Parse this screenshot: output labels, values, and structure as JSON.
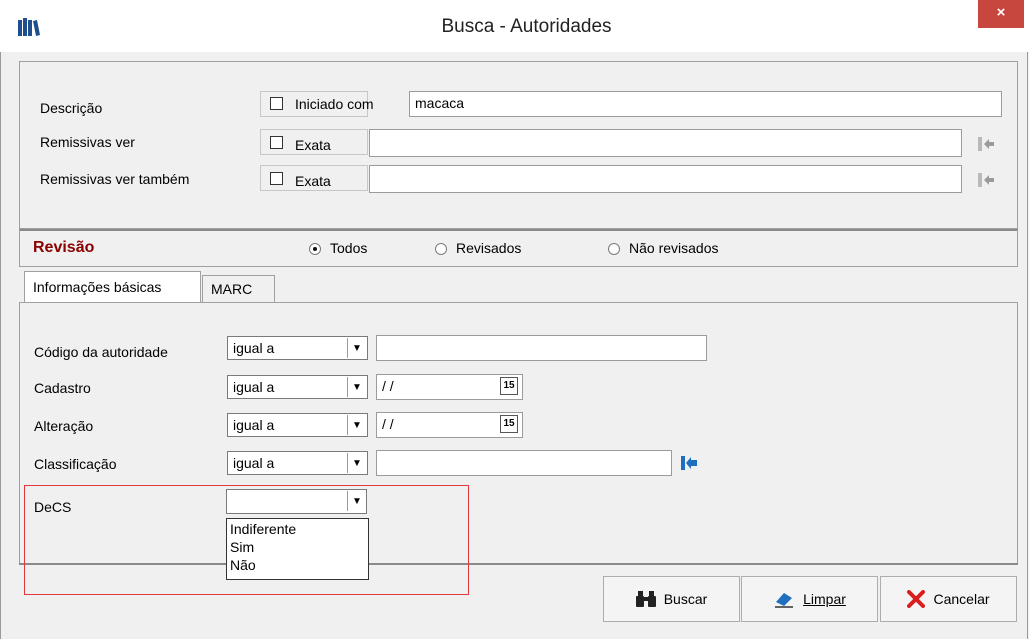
{
  "window": {
    "title": "Busca - Autoridades",
    "close_label": "×"
  },
  "search": {
    "rows": [
      {
        "label": "Descrição",
        "check_label": "Iniciado com",
        "checked": false,
        "value": "macaca"
      },
      {
        "label": "Remissivas ver",
        "check_label": "Exata",
        "checked": false,
        "value": ""
      },
      {
        "label": "Remissivas ver também",
        "check_label": "Exata",
        "checked": false,
        "value": ""
      }
    ]
  },
  "revisao": {
    "heading": "Revisão",
    "options": [
      "Todos",
      "Revisados",
      "Não revisados"
    ],
    "selected": "Todos"
  },
  "tabs": [
    {
      "label": "Informações básicas",
      "active": true
    },
    {
      "label": "MARC",
      "active": false
    }
  ],
  "filters": {
    "codigo": {
      "label": "Código da autoridade",
      "operator": "igual a",
      "value": ""
    },
    "cadastro": {
      "label": "Cadastro",
      "operator": "igual a",
      "value": " / /",
      "calendar": "15"
    },
    "alteracao": {
      "label": "Alteração",
      "operator": "igual a",
      "value": " / /",
      "calendar": "15"
    },
    "classificacao": {
      "label": "Classificação",
      "operator": "igual a",
      "value": ""
    },
    "decs": {
      "label": "DeCS",
      "value": "",
      "options": [
        "Indiferente",
        "Sim",
        "Não"
      ]
    }
  },
  "buttons": {
    "buscar": "Buscar",
    "limpar": "Limpar",
    "cancelar": "Cancelar"
  },
  "colors": {
    "accent_red": "#8b0000",
    "close_red": "#c7463e",
    "highlight": "#e0393b",
    "arrow_blue": "#1f6fbf"
  }
}
